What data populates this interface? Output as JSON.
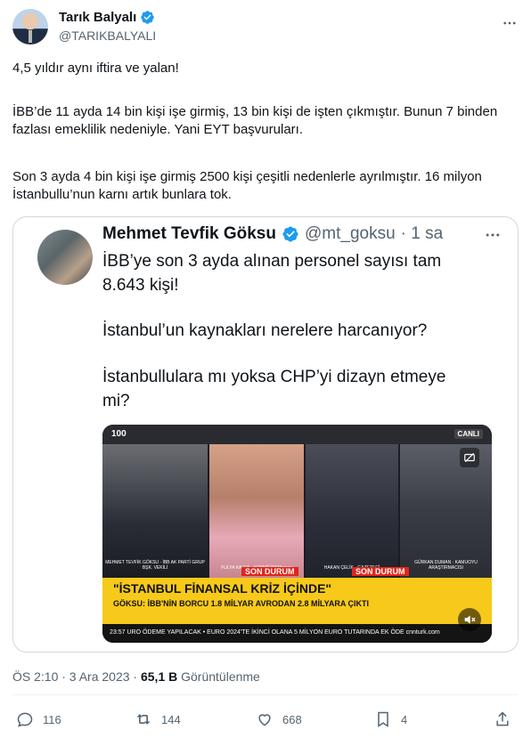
{
  "author": {
    "name": "Tarık Balyalı",
    "handle": "@TARIKBALYALI"
  },
  "tweet": {
    "p1": "4,5 yıldır aynı iftira ve yalan!",
    "p2": "İBB’de 11 ayda 14 bin kişi işe girmiş, 13 bin kişi de işten çıkmıştır. Bunun 7 binden fazlası emeklilik nedeniyle. Yani EYT başvuruları.",
    "p3": "Son 3 ayda 4 bin kişi işe girmiş 2500 kişi çeşitli nedenlerle ayrılmıştır. 16 milyon İstanbullu’nun karnı artık bunlara tok."
  },
  "embedded": {
    "name": "Mehmet Tevfik Göksu",
    "handle": "@mt_goksu",
    "time": "· 1 sa",
    "line1": "İBB’ye son 3 ayda alınan personel sayısı tam",
    "line2": "8.643 kişi!",
    "line3": "İstanbul’un kaynakları nerelere harcanıyor?",
    "line4": "İstanbullulara mı yoksa CHP’yi dizayn etmeye",
    "line5": "mi?"
  },
  "video": {
    "logo": "100",
    "live": "CANLI",
    "cap_a": "MEHMET TEVFİK GÖKSU · İBB AK PARTİ GRUP BŞK. VEKİLİ",
    "cap_b": "FULYA KALFA · #CNNTÜRKMasası",
    "cap_c": "HAKAN ÇELİK · GAZETECİ",
    "cap_d": "GÜRKAN DUMAN · KAMUOYU ARAŞTIRMACISI",
    "son_durum": "SON DURUM",
    "headline": "\"İSTANBUL FİNANSAL KRİZ İÇİNDE\"",
    "subline": "GÖKSU: İBB'NİN BORCU 1.8 MİLYAR AVRODAN 2.8 MİLYARA ÇIKTI",
    "ticker": "23:57  URO ÖDEME YAPILACAK   •   EURO 2024'TE İKİNCİ OLANA 5 MİLYON EURO TUTARINDA EK ÖDE   cnnturk.com"
  },
  "meta": {
    "time": "ÖS 2:10 · 3 Ara 2023 ·",
    "views": "65,1 B",
    "views_label": "Görüntülenme"
  },
  "actions": {
    "replies": "116",
    "retweets": "144",
    "likes": "668",
    "bookmarks": "4"
  },
  "colors": {
    "verified": "#1d9bf0",
    "secondary_text": "#536471"
  }
}
